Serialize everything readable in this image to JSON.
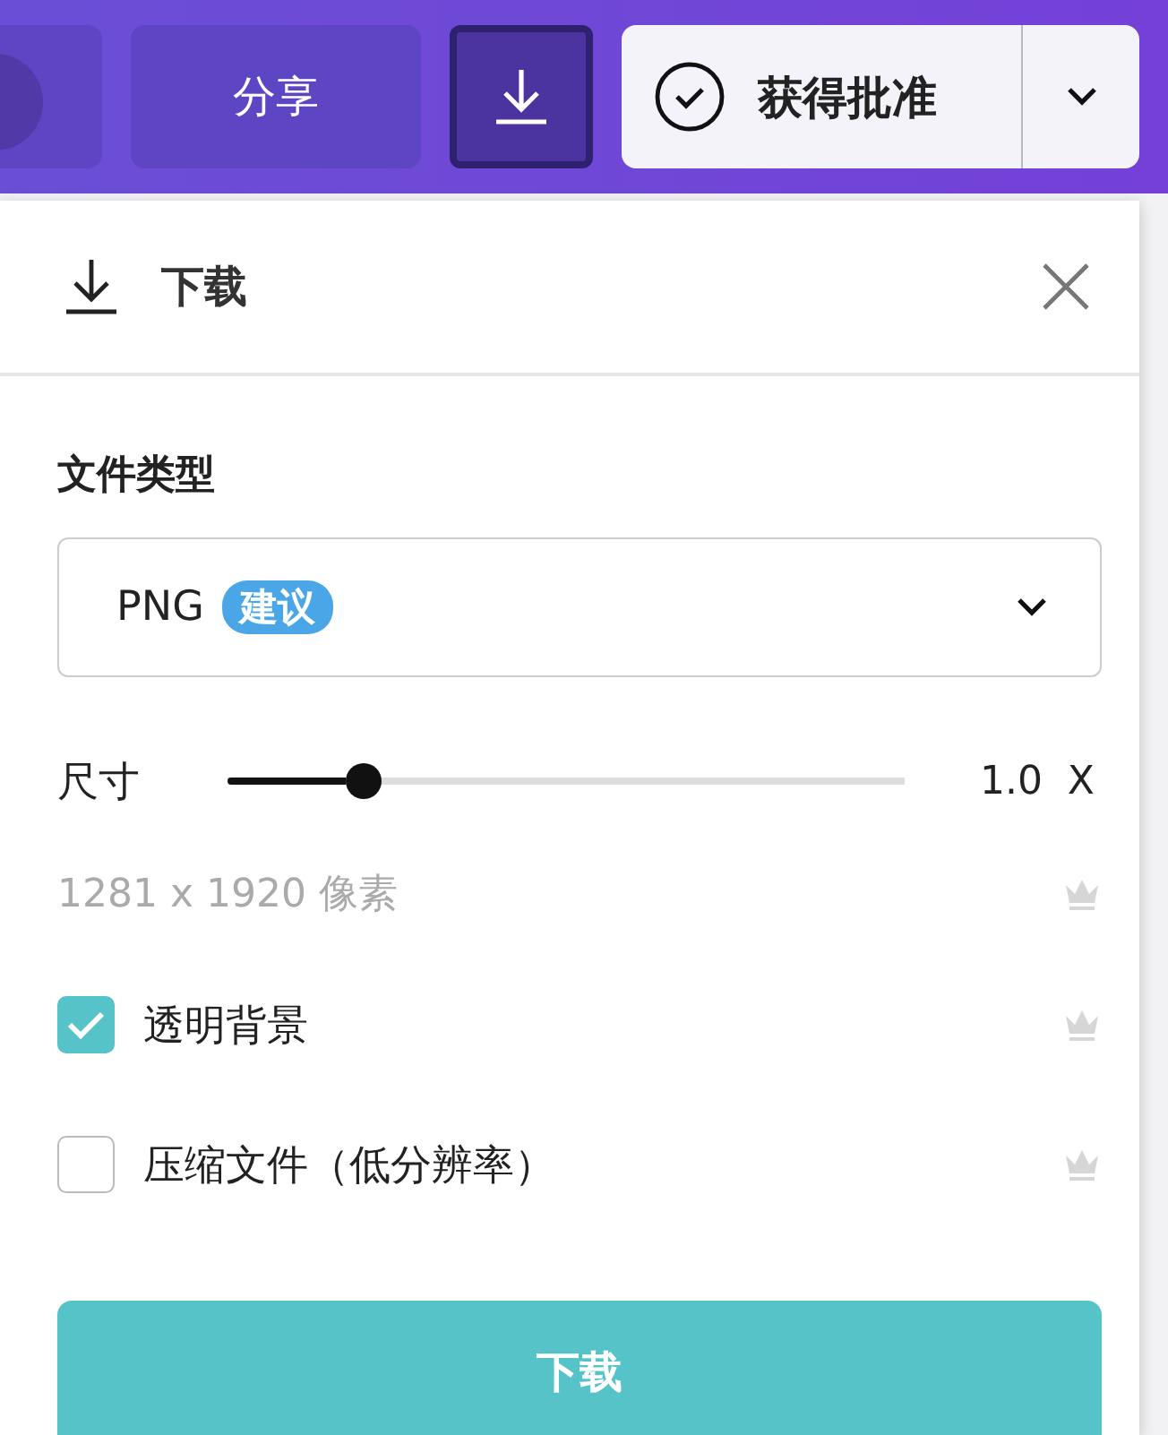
{
  "toolbar": {
    "share_button": "分享",
    "download_button": {
      "selected": true
    },
    "approval_button": "获得批准"
  },
  "download_panel": {
    "title": "下载",
    "file_type": {
      "label": "文件类型",
      "value": "PNG",
      "badge": "建议"
    },
    "size": {
      "label": "尺寸",
      "level": 0.2,
      "reading": "1.0  X"
    },
    "pixels": "1281 x 1920 像素",
    "options": [
      {
        "kind": "checkbox",
        "label": "透明背景",
        "checked": true
      },
      {
        "kind": "checkbox",
        "label": "压缩文件（低分辨率）",
        "checked": false
      }
    ],
    "submit_button": "下载"
  }
}
